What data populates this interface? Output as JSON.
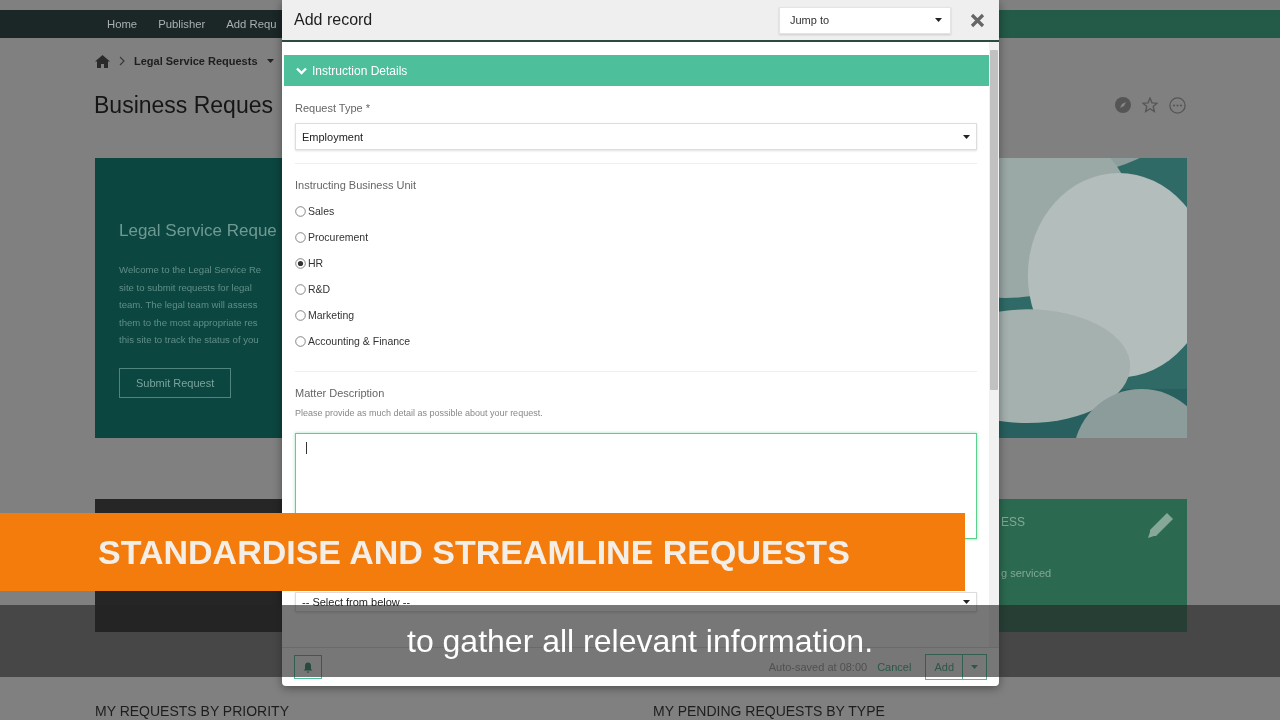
{
  "top_nav": {
    "items": [
      {
        "label": "Home"
      },
      {
        "label": "Publisher"
      },
      {
        "label": "Add Requ"
      }
    ]
  },
  "breadcrumb": {
    "label": "Legal Service Requests"
  },
  "page_title": "Business Reques",
  "hero": {
    "title": "Legal Service Reque",
    "lines": [
      "Welcome to the Legal Service Re",
      "site to submit requests for legal",
      "team. The legal team will assess",
      "them to the most appropriate res",
      "this site to track the status of you"
    ],
    "button": "Submit Request"
  },
  "cards": [
    {
      "kind": "plain"
    },
    {
      "kind": "status",
      "title": "ESS",
      "text": "g serviced"
    }
  ],
  "section_headings": [
    "MY REQUESTS BY PRIORITY",
    "MY PENDING REQUESTS BY TYPE"
  ],
  "modal": {
    "title": "Add record",
    "jump_to": "Jump to",
    "section": {
      "title": "Instruction Details",
      "expanded": true
    },
    "fields": [
      {
        "kind": "select",
        "label": "Request Type *",
        "value": "Employment"
      },
      {
        "kind": "radio",
        "label": "Instructing Business Unit",
        "options": [
          {
            "label": "Sales",
            "selected": false
          },
          {
            "label": "Procurement",
            "selected": false
          },
          {
            "label": "HR",
            "selected": true
          },
          {
            "label": "R&D",
            "selected": false
          },
          {
            "label": "Marketing",
            "selected": false
          },
          {
            "label": "Accounting & Finance",
            "selected": false
          }
        ]
      },
      {
        "kind": "textarea",
        "label": "Matter Description",
        "hint": "Please provide as much detail as possible about your request.",
        "focused": true
      },
      {
        "kind": "select",
        "value": "-- Select from below --"
      }
    ],
    "footer": {
      "status": "Auto-saved at 08:00",
      "cancel": "Cancel",
      "submit": "Add"
    }
  },
  "banner": "STANDARDISE AND STREAMLINE REQUESTS",
  "caption": "to gather all relevant information."
}
